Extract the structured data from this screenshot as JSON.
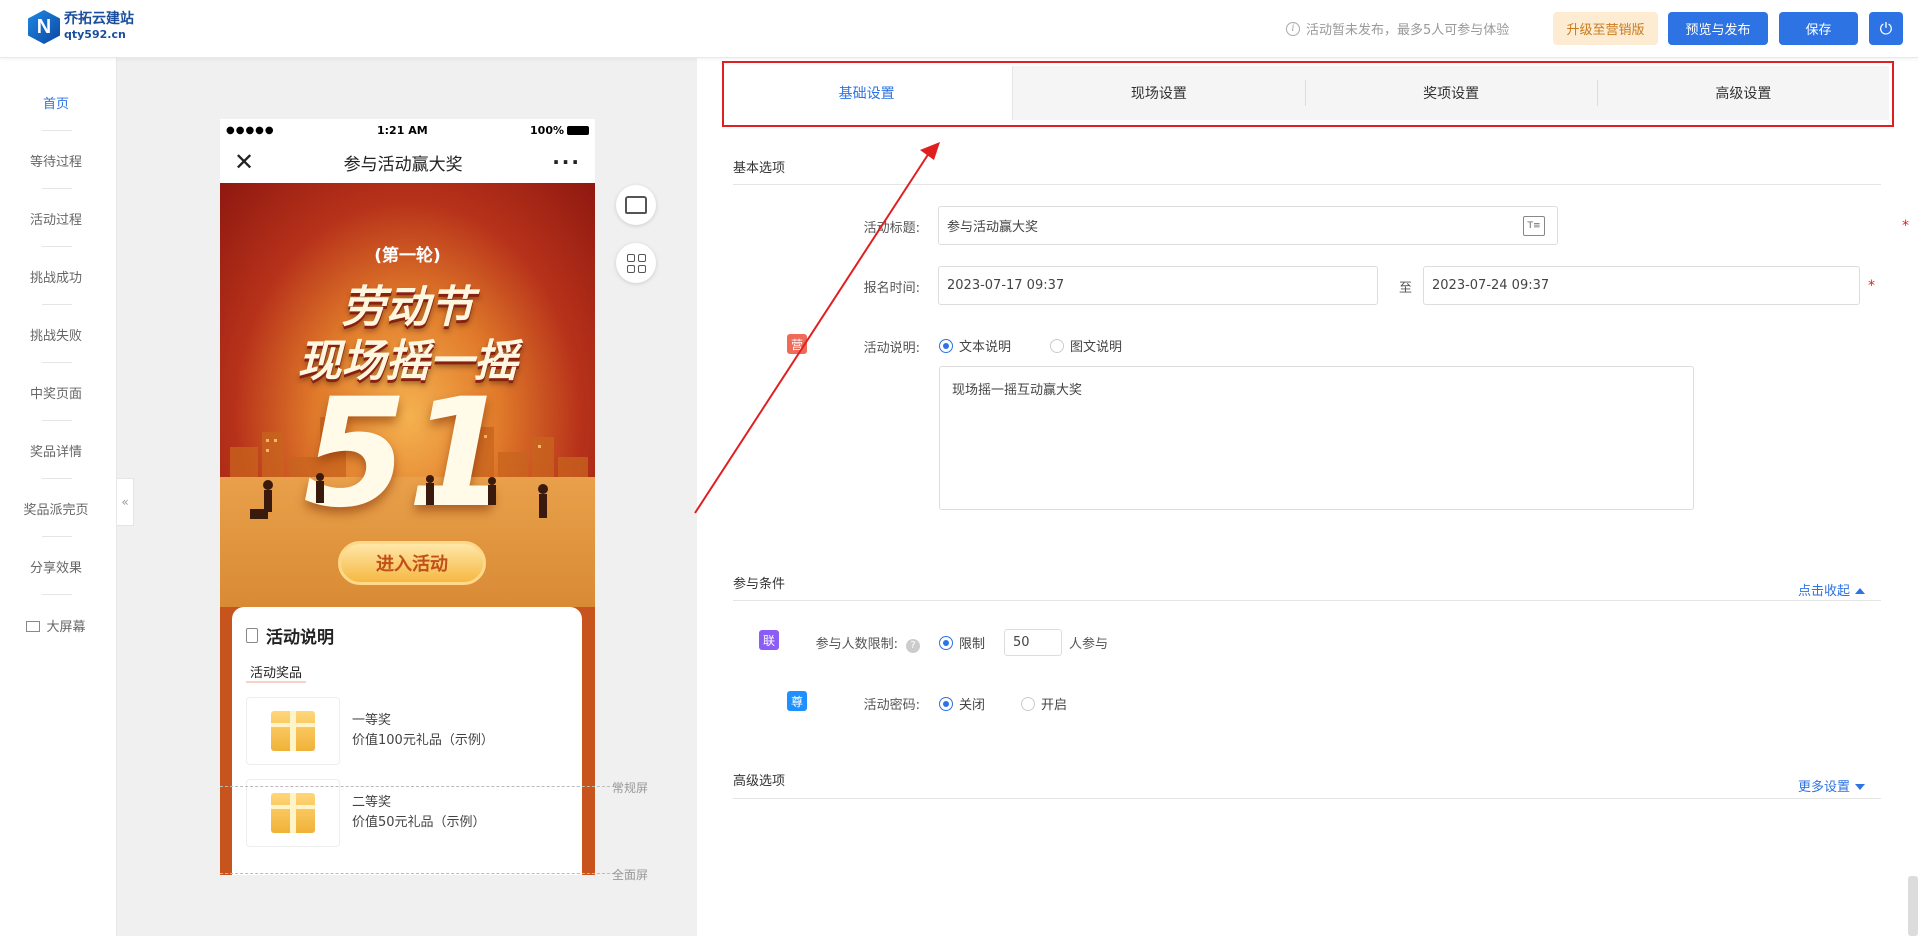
{
  "app": {
    "logo_mark": "N",
    "logo_name": "乔拓云建站",
    "logo_url": "qty592.cn"
  },
  "header": {
    "notice": "活动暂未发布，最多5人可参与体验",
    "upgrade_label": "升级至营销版",
    "preview_label": "预览与发布",
    "save_label": "保存"
  },
  "sidebar": {
    "items": [
      {
        "label": "首页"
      },
      {
        "label": "等待过程"
      },
      {
        "label": "活动过程"
      },
      {
        "label": "挑战成功"
      },
      {
        "label": "挑战失败"
      },
      {
        "label": "中奖页面"
      },
      {
        "label": "奖品详情"
      },
      {
        "label": "奖品派完页"
      },
      {
        "label": "分享效果"
      },
      {
        "label": "大屏幕"
      }
    ]
  },
  "phone": {
    "signal": "●●●●●",
    "time": "1:21 AM",
    "battery": "100%",
    "title": "参与活动赢大奖",
    "banner_round": "(第一轮)",
    "banner_line1": "劳动节",
    "banner_line2": "现场摇一摇",
    "banner_number": "51",
    "enter_label": "进入活动",
    "card_title": "活动说明",
    "card_subtitle": "活动奖品",
    "prizes": [
      {
        "name": "一等奖",
        "value": "价值100元礼品（示例）"
      },
      {
        "name": "二等奖",
        "value": "价值50元礼品（示例）"
      }
    ],
    "guide_normal": "常规屏",
    "guide_full": "全面屏"
  },
  "tabs": [
    {
      "label": "基础设置"
    },
    {
      "label": "现场设置"
    },
    {
      "label": "奖项设置"
    },
    {
      "label": "高级设置"
    }
  ],
  "basic": {
    "section_title": "基本选项",
    "title_label": "活动标题:",
    "title_value": "参与活动赢大奖",
    "signup_label": "报名时间:",
    "start_time": "2023-07-17 09:37",
    "to_label": "至",
    "end_time": "2023-07-24 09:37",
    "desc_badge": "营",
    "desc_label": "活动说明:",
    "desc_option_text": "文本说明",
    "desc_option_rich": "图文说明",
    "desc_value": "现场摇一摇互动赢大奖"
  },
  "conditions": {
    "section_title": "参与条件",
    "collapse_link": "点击收起",
    "limit_badge": "联",
    "limit_label": "参与人数限制:",
    "limit_option": "限制",
    "limit_value": "50",
    "limit_suffix": "人参与",
    "pwd_badge": "尊",
    "pwd_label": "活动密码:",
    "pwd_off": "关闭",
    "pwd_on": "开启"
  },
  "advanced": {
    "section_title": "高级选项",
    "more_link": "更多设置"
  },
  "colors": {
    "primary": "#2d73e3",
    "annotation": "#e02020",
    "badge_purple": "#8b5cf6",
    "badge_blue": "#1e90ff",
    "badge_red": "#f06a5a"
  }
}
